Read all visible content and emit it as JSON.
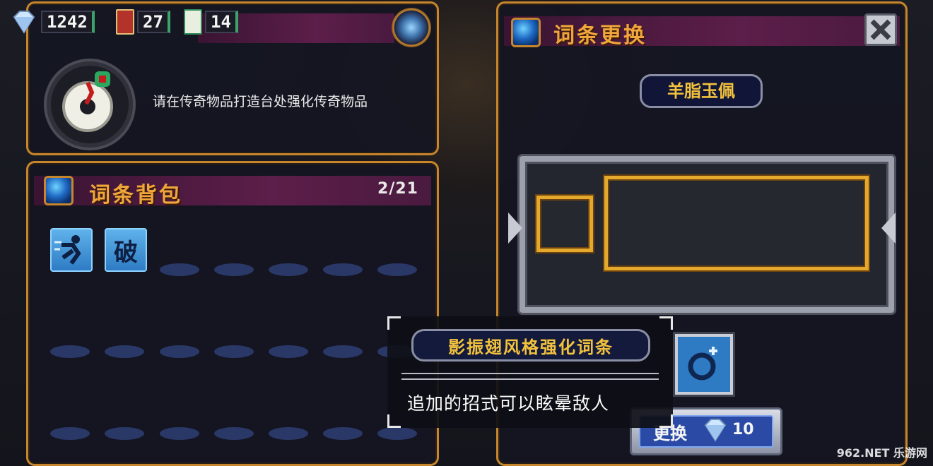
{
  "currency": {
    "gems": "1242",
    "red_tickets": "27",
    "green_cards": "14"
  },
  "legend": {
    "description": "请在传奇物品打造台处强化传奇物品"
  },
  "bag": {
    "title": "词条背包",
    "count": "2/21",
    "items": [
      {
        "icon": "running-figure-icon"
      },
      {
        "icon": "break-glyph-icon",
        "glyph": "破"
      }
    ]
  },
  "swap": {
    "title": "词条更换",
    "item_name": "羊脂玉佩",
    "button_label": "更换",
    "cost": "10"
  },
  "tooltip": {
    "title": "影振翅风格强化词条",
    "description": "追加的招式可以眩晕敌人"
  },
  "watermark": "962.NET 乐游网",
  "colors": {
    "accent_gold": "#c7862d",
    "title_orange": "#f0a63b",
    "header_purple": "#5c1e4a",
    "plaque_yellow": "#f2c23d"
  }
}
